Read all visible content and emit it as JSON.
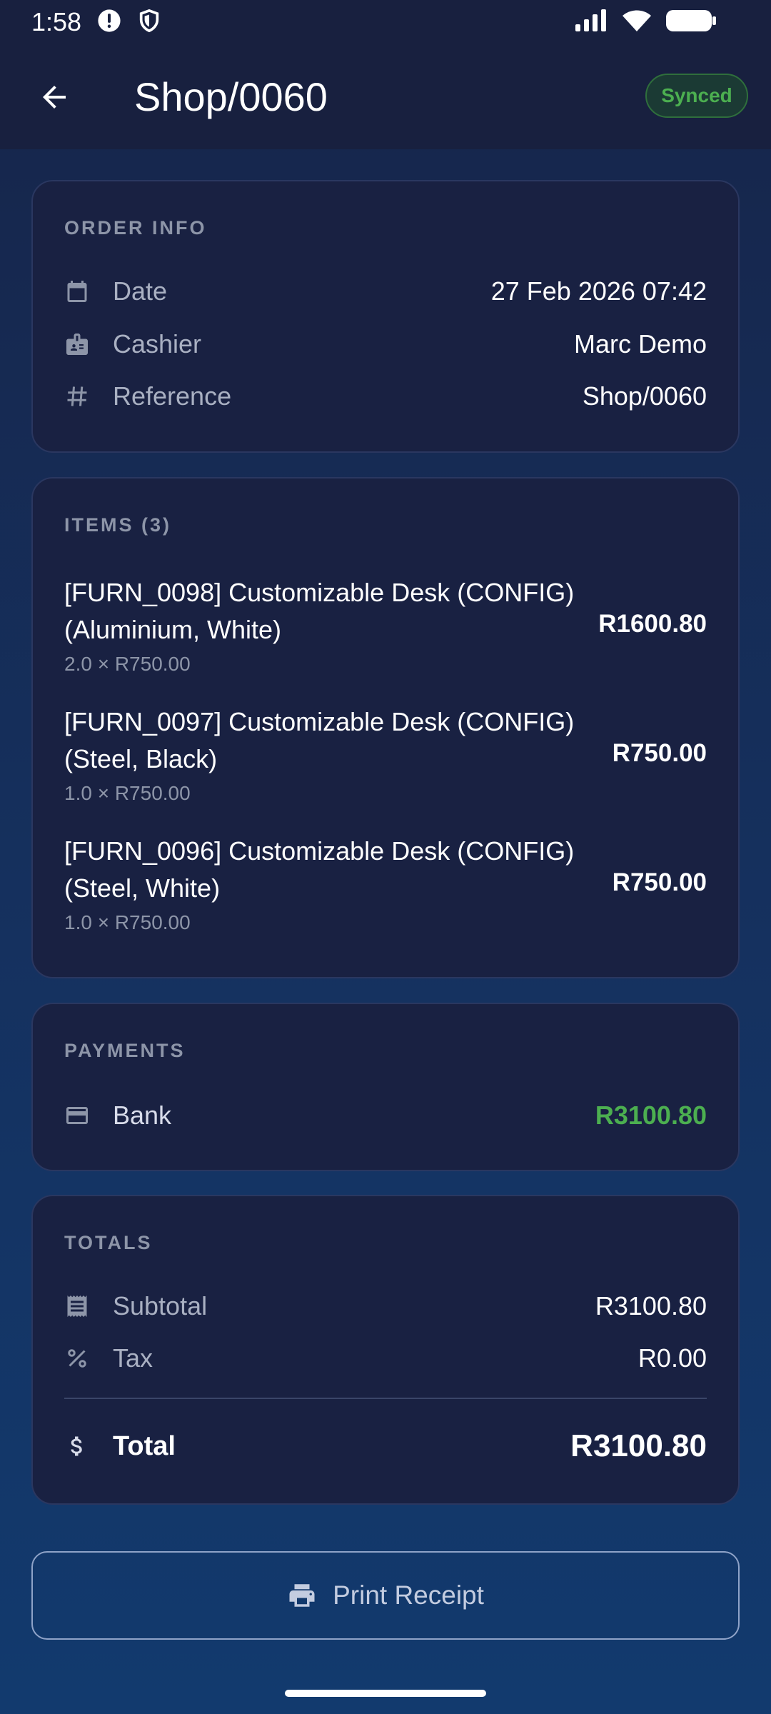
{
  "status_bar": {
    "time": "1:58"
  },
  "app_bar": {
    "title": "Shop/0060",
    "badge": "Synced"
  },
  "order_info": {
    "header": "ORDER INFO",
    "rows": [
      {
        "icon": "calendar-icon",
        "label": "Date",
        "value": "27 Feb 2026 07:42"
      },
      {
        "icon": "badge-icon",
        "label": "Cashier",
        "value": "Marc Demo"
      },
      {
        "icon": "hash-icon",
        "label": "Reference",
        "value": "Shop/0060"
      }
    ]
  },
  "items": {
    "header": "ITEMS (3)",
    "list": [
      {
        "line1": "[FURN_0098] Customizable Desk (CONFIG)",
        "line2": "(Aluminium, White)",
        "qty": "2.0 × R750.00",
        "price": "R1600.80"
      },
      {
        "line1": "[FURN_0097] Customizable Desk (CONFIG)",
        "line2": "(Steel, Black)",
        "qty": "1.0 × R750.00",
        "price": "R750.00"
      },
      {
        "line1": "[FURN_0096] Customizable Desk (CONFIG)",
        "line2": "(Steel, White)",
        "qty": "1.0 × R750.00",
        "price": "R750.00"
      }
    ]
  },
  "payments": {
    "header": "PAYMENTS",
    "rows": [
      {
        "icon": "credit-card-icon",
        "label": "Bank",
        "value": "R3100.80"
      }
    ]
  },
  "totals": {
    "header": "TOTALS",
    "subtotal_label": "Subtotal",
    "subtotal_value": "R3100.80",
    "tax_label": "Tax",
    "tax_value": "R0.00",
    "total_label": "Total",
    "total_value": "R3100.80"
  },
  "actions": {
    "print_label": "Print Receipt"
  },
  "colors": {
    "accent_green": "#4caf50",
    "card_bg": "#192142",
    "topbar_bg": "#18203f"
  }
}
